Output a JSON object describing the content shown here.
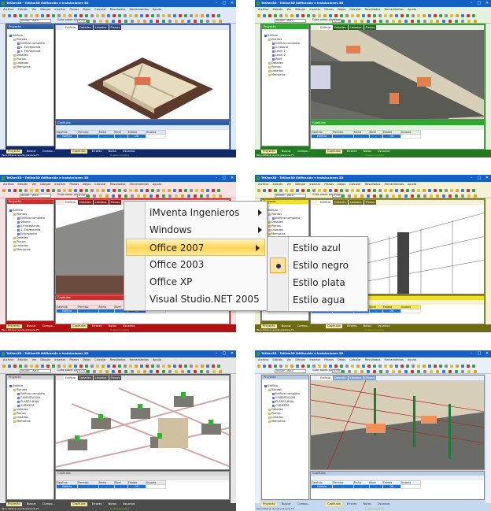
{
  "app": {
    "title": "TeKton3D - TeKton3D Edificación e instalaciones 3D",
    "menu": [
      "Archivo",
      "Edición",
      "Ver",
      "Dibujar",
      "Insertar",
      "Planos",
      "Dejos",
      "Calcular",
      "Resultados",
      "Herramientas",
      "Ayuda"
    ],
    "layer_value": "Inicial - Azul",
    "height_label": "Cota sobre planta",
    "height_value": "0,00",
    "project_panel": "Proyecto",
    "view_tabs": [
      "Edificio",
      "Detalles",
      "Listados",
      "Planos"
    ],
    "chapters_panel": "Capítulos",
    "chapters_columns": [
      "Capítulo",
      "Permiso",
      "Fecha",
      "Nivel",
      "Estado",
      "Usuario"
    ],
    "chapters_row": {
      "name": "Edificio",
      "permiso": "-",
      "fecha": "-",
      "nivel": "-",
      "estado": "OK"
    },
    "bottom_tabs_left": [
      "Proyecto",
      "Buscar",
      "Compo..."
    ],
    "bottom_tabs_right": [
      "Capítulos",
      "Errores",
      "Notas",
      "Usuarios"
    ],
    "status": "Para obtener ayuda presione F1",
    "status_mid": "0 seleccionados"
  },
  "windows": [
    {
      "theme": {
        "frame": "#10296a",
        "bar": "#dfe8f6",
        "hdr": "#2c5ea8",
        "hdrtxt": "#ffffff",
        "tab": "#27457e",
        "thbg": "#dbe6f6",
        "btxt": "#ffffff"
      },
      "view": "house",
      "tree": [
        "Edificio",
        "Plantas",
        "Edificio completo",
        "0. Entreplanta",
        "1. Entreplanta",
        "Detalles",
        "Planos",
        "Listados",
        "Memorias"
      ]
    },
    {
      "theme": {
        "frame": "#1f7a20",
        "bar": "#e6f2e0",
        "hdr": "#2ea72e",
        "hdrtxt": "#ffffff",
        "tab": "#1c6a1c",
        "thbg": "#e0f0dc",
        "btxt": "#ffffff"
      },
      "view": "interior",
      "tree": [
        "Edificio",
        "Plantas",
        "Edificio completo",
        "S.Sótano",
        "Level 1",
        "Level 2",
        "Roof",
        "Detalles",
        "Planos",
        "Listados",
        "Memorias"
      ]
    },
    {
      "theme": {
        "frame": "#b01212",
        "bar": "#f6e2e2",
        "hdr": "#c83030",
        "hdrtxt": "#ffffff",
        "tab": "#8a1a1a",
        "thbg": "#f6dcdc",
        "btxt": "#ffffff"
      },
      "view": "building",
      "tree": [
        "Edificio",
        "Plantas",
        "Edificio completo",
        "Sótano",
        "0.Entreplanta",
        "1. Entreplanta",
        "Entreplanta",
        "Detalles",
        "Planos",
        "Listados",
        "Memorias"
      ]
    },
    {
      "theme": {
        "frame": "#6e6a12",
        "bar": "#f4f2d6",
        "hdr": "#efe12a",
        "hdrtxt": "#222222",
        "tab": "#6e6a12",
        "thbg": "#f4ec40",
        "btxt": "#ffffff"
      },
      "view": "wire",
      "tree": [
        "Edificio",
        "Plantas",
        "Edificio completo",
        "Detalles",
        "Planos",
        "Listados",
        "Memorias"
      ]
    },
    {
      "theme": {
        "frame": "#4c4c4c",
        "bar": "#e6e6e6",
        "hdr": "#d6d6d6",
        "hdrtxt": "#333333",
        "tab": "#555555",
        "thbg": "#e8e8e8",
        "btxt": "#ffffff"
      },
      "view": "foundation",
      "tree": [
        "Edificio",
        "Plantas",
        "Edificio completo",
        "CIMENTACIÓN",
        "PLANTA BAJA",
        "CUBIERTA",
        "Detalles",
        "Planos",
        "Listados",
        "Memorias"
      ]
    },
    {
      "theme": {
        "frame": "#c4d8f0",
        "bar": "#e8f0fa",
        "hdr": "#b4cdea",
        "hdrtxt": "#223355",
        "tab": "#7fa4d2",
        "thbg": "#eef4fb",
        "btxt": "#223355"
      },
      "view": "structure",
      "tree": [
        "Edificio",
        "Plantas",
        "Edificio completo",
        "CIMENTACIÓN",
        "PLANTA BAJA",
        "CUBIERTA",
        "Detalles",
        "Planos",
        "Listados",
        "Memorias"
      ]
    }
  ],
  "style_menu": {
    "items": [
      {
        "label": "iMventa Ingenieros",
        "submenu": true
      },
      {
        "label": "Windows",
        "submenu": true
      },
      {
        "label": "Office 2007",
        "submenu": true,
        "highlighted": true
      },
      {
        "label": "Office 2003"
      },
      {
        "label": "Office XP"
      },
      {
        "label": "Visual Studio.NET 2005"
      }
    ],
    "submenu": [
      {
        "label": "Estilo azul"
      },
      {
        "label": "Estilo negro",
        "checked": true
      },
      {
        "label": "Estilo plata"
      },
      {
        "label": "Estilo agua"
      }
    ]
  }
}
